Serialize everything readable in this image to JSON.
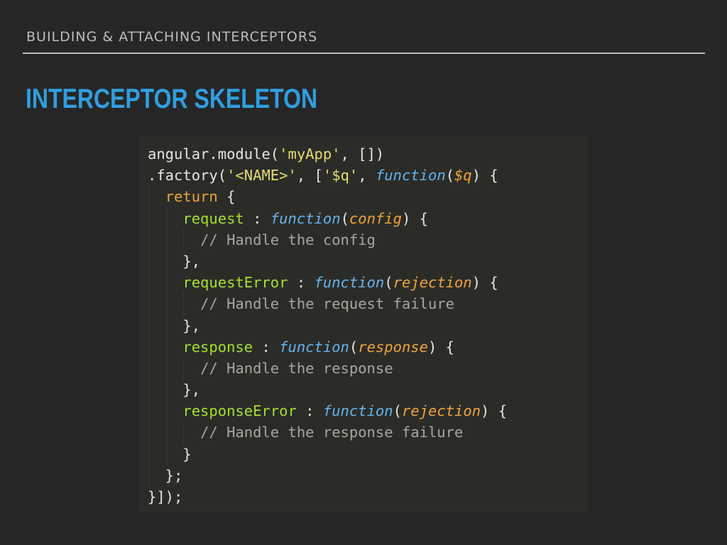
{
  "slide": {
    "section_header": "BUILDING & ATTACHING INTERCEPTORS",
    "title": "INTERCEPTOR SKELETON"
  },
  "colors": {
    "background": "#262626",
    "title": "#2f9fe0",
    "code_background": "#2b2c28",
    "string": "#e6db74",
    "function_keyword": "#66b3ee",
    "parameter": "#f0a43a",
    "keyword": "#f0a43a",
    "property": "#a6e22e",
    "comment": "#a8a89a",
    "plain": "#e5e5e5"
  },
  "code": {
    "language": "javascript",
    "lines": [
      [
        {
          "t": "pl",
          "v": "angular.module("
        },
        {
          "t": "str",
          "v": "'myApp'"
        },
        {
          "t": "pl",
          "v": ", [])"
        }
      ],
      [
        {
          "t": "pl",
          "v": ".factory("
        },
        {
          "t": "str",
          "v": "'<NAME>'"
        },
        {
          "t": "pl",
          "v": ", ["
        },
        {
          "t": "str",
          "v": "'$q'"
        },
        {
          "t": "pl",
          "v": ", "
        },
        {
          "t": "fn",
          "v": "function"
        },
        {
          "t": "pl",
          "v": "("
        },
        {
          "t": "prm",
          "v": "$q"
        },
        {
          "t": "pl",
          "v": ") {"
        }
      ],
      [
        {
          "t": "pl",
          "v": "  "
        },
        {
          "t": "kw",
          "v": "return"
        },
        {
          "t": "pl",
          "v": " {"
        }
      ],
      [
        {
          "t": "pl",
          "v": "    "
        },
        {
          "t": "key",
          "v": "request"
        },
        {
          "t": "pl",
          "v": " : "
        },
        {
          "t": "fn",
          "v": "function"
        },
        {
          "t": "pl",
          "v": "("
        },
        {
          "t": "prm",
          "v": "config"
        },
        {
          "t": "pl",
          "v": ") {"
        }
      ],
      [
        {
          "t": "pl",
          "v": "      "
        },
        {
          "t": "cm",
          "v": "// Handle the config"
        }
      ],
      [
        {
          "t": "pl",
          "v": "    },"
        }
      ],
      [
        {
          "t": "pl",
          "v": "    "
        },
        {
          "t": "key",
          "v": "requestError"
        },
        {
          "t": "pl",
          "v": " : "
        },
        {
          "t": "fn",
          "v": "function"
        },
        {
          "t": "pl",
          "v": "("
        },
        {
          "t": "prm",
          "v": "rejection"
        },
        {
          "t": "pl",
          "v": ") {"
        }
      ],
      [
        {
          "t": "pl",
          "v": "      "
        },
        {
          "t": "cm",
          "v": "// Handle the request failure"
        }
      ],
      [
        {
          "t": "pl",
          "v": "    },"
        }
      ],
      [
        {
          "t": "pl",
          "v": "    "
        },
        {
          "t": "key",
          "v": "response"
        },
        {
          "t": "pl",
          "v": " : "
        },
        {
          "t": "fn",
          "v": "function"
        },
        {
          "t": "pl",
          "v": "("
        },
        {
          "t": "prm",
          "v": "response"
        },
        {
          "t": "pl",
          "v": ") {"
        }
      ],
      [
        {
          "t": "pl",
          "v": "      "
        },
        {
          "t": "cm",
          "v": "// Handle the response"
        }
      ],
      [
        {
          "t": "pl",
          "v": "    },"
        }
      ],
      [
        {
          "t": "pl",
          "v": "    "
        },
        {
          "t": "key",
          "v": "responseError"
        },
        {
          "t": "pl",
          "v": " : "
        },
        {
          "t": "fn",
          "v": "function"
        },
        {
          "t": "pl",
          "v": "("
        },
        {
          "t": "prm",
          "v": "rejection"
        },
        {
          "t": "pl",
          "v": ") {"
        }
      ],
      [
        {
          "t": "pl",
          "v": "      "
        },
        {
          "t": "cm",
          "v": "// Handle the response failure"
        }
      ],
      [
        {
          "t": "pl",
          "v": "    }"
        }
      ],
      [
        {
          "t": "pl",
          "v": "  };"
        }
      ],
      [
        {
          "t": "pl",
          "v": "}]);"
        }
      ]
    ]
  }
}
